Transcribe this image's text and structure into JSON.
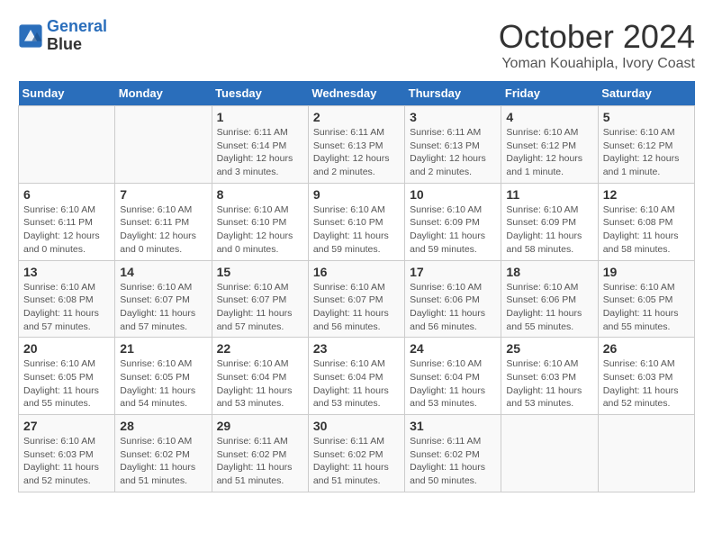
{
  "header": {
    "logo_line1": "General",
    "logo_line2": "Blue",
    "month": "October 2024",
    "location": "Yoman Kouahipla, Ivory Coast"
  },
  "weekdays": [
    "Sunday",
    "Monday",
    "Tuesday",
    "Wednesday",
    "Thursday",
    "Friday",
    "Saturday"
  ],
  "weeks": [
    [
      {
        "day": "",
        "info": ""
      },
      {
        "day": "",
        "info": ""
      },
      {
        "day": "1",
        "info": "Sunrise: 6:11 AM\nSunset: 6:14 PM\nDaylight: 12 hours\nand 3 minutes."
      },
      {
        "day": "2",
        "info": "Sunrise: 6:11 AM\nSunset: 6:13 PM\nDaylight: 12 hours\nand 2 minutes."
      },
      {
        "day": "3",
        "info": "Sunrise: 6:11 AM\nSunset: 6:13 PM\nDaylight: 12 hours\nand 2 minutes."
      },
      {
        "day": "4",
        "info": "Sunrise: 6:10 AM\nSunset: 6:12 PM\nDaylight: 12 hours\nand 1 minute."
      },
      {
        "day": "5",
        "info": "Sunrise: 6:10 AM\nSunset: 6:12 PM\nDaylight: 12 hours\nand 1 minute."
      }
    ],
    [
      {
        "day": "6",
        "info": "Sunrise: 6:10 AM\nSunset: 6:11 PM\nDaylight: 12 hours\nand 0 minutes."
      },
      {
        "day": "7",
        "info": "Sunrise: 6:10 AM\nSunset: 6:11 PM\nDaylight: 12 hours\nand 0 minutes."
      },
      {
        "day": "8",
        "info": "Sunrise: 6:10 AM\nSunset: 6:10 PM\nDaylight: 12 hours\nand 0 minutes."
      },
      {
        "day": "9",
        "info": "Sunrise: 6:10 AM\nSunset: 6:10 PM\nDaylight: 11 hours\nand 59 minutes."
      },
      {
        "day": "10",
        "info": "Sunrise: 6:10 AM\nSunset: 6:09 PM\nDaylight: 11 hours\nand 59 minutes."
      },
      {
        "day": "11",
        "info": "Sunrise: 6:10 AM\nSunset: 6:09 PM\nDaylight: 11 hours\nand 58 minutes."
      },
      {
        "day": "12",
        "info": "Sunrise: 6:10 AM\nSunset: 6:08 PM\nDaylight: 11 hours\nand 58 minutes."
      }
    ],
    [
      {
        "day": "13",
        "info": "Sunrise: 6:10 AM\nSunset: 6:08 PM\nDaylight: 11 hours\nand 57 minutes."
      },
      {
        "day": "14",
        "info": "Sunrise: 6:10 AM\nSunset: 6:07 PM\nDaylight: 11 hours\nand 57 minutes."
      },
      {
        "day": "15",
        "info": "Sunrise: 6:10 AM\nSunset: 6:07 PM\nDaylight: 11 hours\nand 57 minutes."
      },
      {
        "day": "16",
        "info": "Sunrise: 6:10 AM\nSunset: 6:07 PM\nDaylight: 11 hours\nand 56 minutes."
      },
      {
        "day": "17",
        "info": "Sunrise: 6:10 AM\nSunset: 6:06 PM\nDaylight: 11 hours\nand 56 minutes."
      },
      {
        "day": "18",
        "info": "Sunrise: 6:10 AM\nSunset: 6:06 PM\nDaylight: 11 hours\nand 55 minutes."
      },
      {
        "day": "19",
        "info": "Sunrise: 6:10 AM\nSunset: 6:05 PM\nDaylight: 11 hours\nand 55 minutes."
      }
    ],
    [
      {
        "day": "20",
        "info": "Sunrise: 6:10 AM\nSunset: 6:05 PM\nDaylight: 11 hours\nand 55 minutes."
      },
      {
        "day": "21",
        "info": "Sunrise: 6:10 AM\nSunset: 6:05 PM\nDaylight: 11 hours\nand 54 minutes."
      },
      {
        "day": "22",
        "info": "Sunrise: 6:10 AM\nSunset: 6:04 PM\nDaylight: 11 hours\nand 53 minutes."
      },
      {
        "day": "23",
        "info": "Sunrise: 6:10 AM\nSunset: 6:04 PM\nDaylight: 11 hours\nand 53 minutes."
      },
      {
        "day": "24",
        "info": "Sunrise: 6:10 AM\nSunset: 6:04 PM\nDaylight: 11 hours\nand 53 minutes."
      },
      {
        "day": "25",
        "info": "Sunrise: 6:10 AM\nSunset: 6:03 PM\nDaylight: 11 hours\nand 53 minutes."
      },
      {
        "day": "26",
        "info": "Sunrise: 6:10 AM\nSunset: 6:03 PM\nDaylight: 11 hours\nand 52 minutes."
      }
    ],
    [
      {
        "day": "27",
        "info": "Sunrise: 6:10 AM\nSunset: 6:03 PM\nDaylight: 11 hours\nand 52 minutes."
      },
      {
        "day": "28",
        "info": "Sunrise: 6:10 AM\nSunset: 6:02 PM\nDaylight: 11 hours\nand 51 minutes."
      },
      {
        "day": "29",
        "info": "Sunrise: 6:11 AM\nSunset: 6:02 PM\nDaylight: 11 hours\nand 51 minutes."
      },
      {
        "day": "30",
        "info": "Sunrise: 6:11 AM\nSunset: 6:02 PM\nDaylight: 11 hours\nand 51 minutes."
      },
      {
        "day": "31",
        "info": "Sunrise: 6:11 AM\nSunset: 6:02 PM\nDaylight: 11 hours\nand 50 minutes."
      },
      {
        "day": "",
        "info": ""
      },
      {
        "day": "",
        "info": ""
      }
    ]
  ]
}
